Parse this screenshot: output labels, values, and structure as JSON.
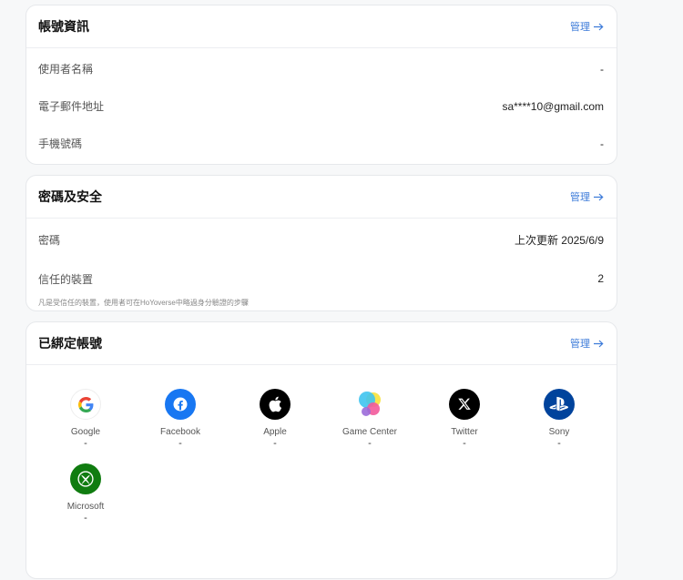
{
  "account_info": {
    "title": "帳號資訊",
    "manage_label": "管理",
    "rows": [
      {
        "label": "使用者名稱",
        "value": "-"
      },
      {
        "label": "電子郵件地址",
        "value": "sa****10@gmail.com"
      },
      {
        "label": "手機號碼",
        "value": "-"
      }
    ]
  },
  "security": {
    "title": "密碼及安全",
    "manage_label": "管理",
    "password_label": "密碼",
    "password_value": "上次更新 2025/6/9",
    "devices_label": "信任的裝置",
    "devices_value": "2",
    "devices_hint": "凡是受信任的裝置，使用者可在HoYoverse中略過身分驗證的步驟"
  },
  "linked": {
    "title": "已綁定帳號",
    "manage_label": "管理",
    "accounts": [
      {
        "name": "Google",
        "status": "-",
        "icon": "google-icon"
      },
      {
        "name": "Facebook",
        "status": "-",
        "icon": "facebook-icon"
      },
      {
        "name": "Apple",
        "status": "-",
        "icon": "apple-icon"
      },
      {
        "name": "Game Center",
        "status": "-",
        "icon": "game-center-icon"
      },
      {
        "name": "Twitter",
        "status": "-",
        "icon": "x-twitter-icon"
      },
      {
        "name": "Sony",
        "status": "-",
        "icon": "playstation-icon"
      },
      {
        "name": "Microsoft",
        "status": "-",
        "icon": "xbox-icon"
      }
    ]
  },
  "colors": {
    "accent": "#3d7bd9",
    "facebook": "#1877f2",
    "playstation": "#00439c",
    "xbox": "#107c10"
  }
}
